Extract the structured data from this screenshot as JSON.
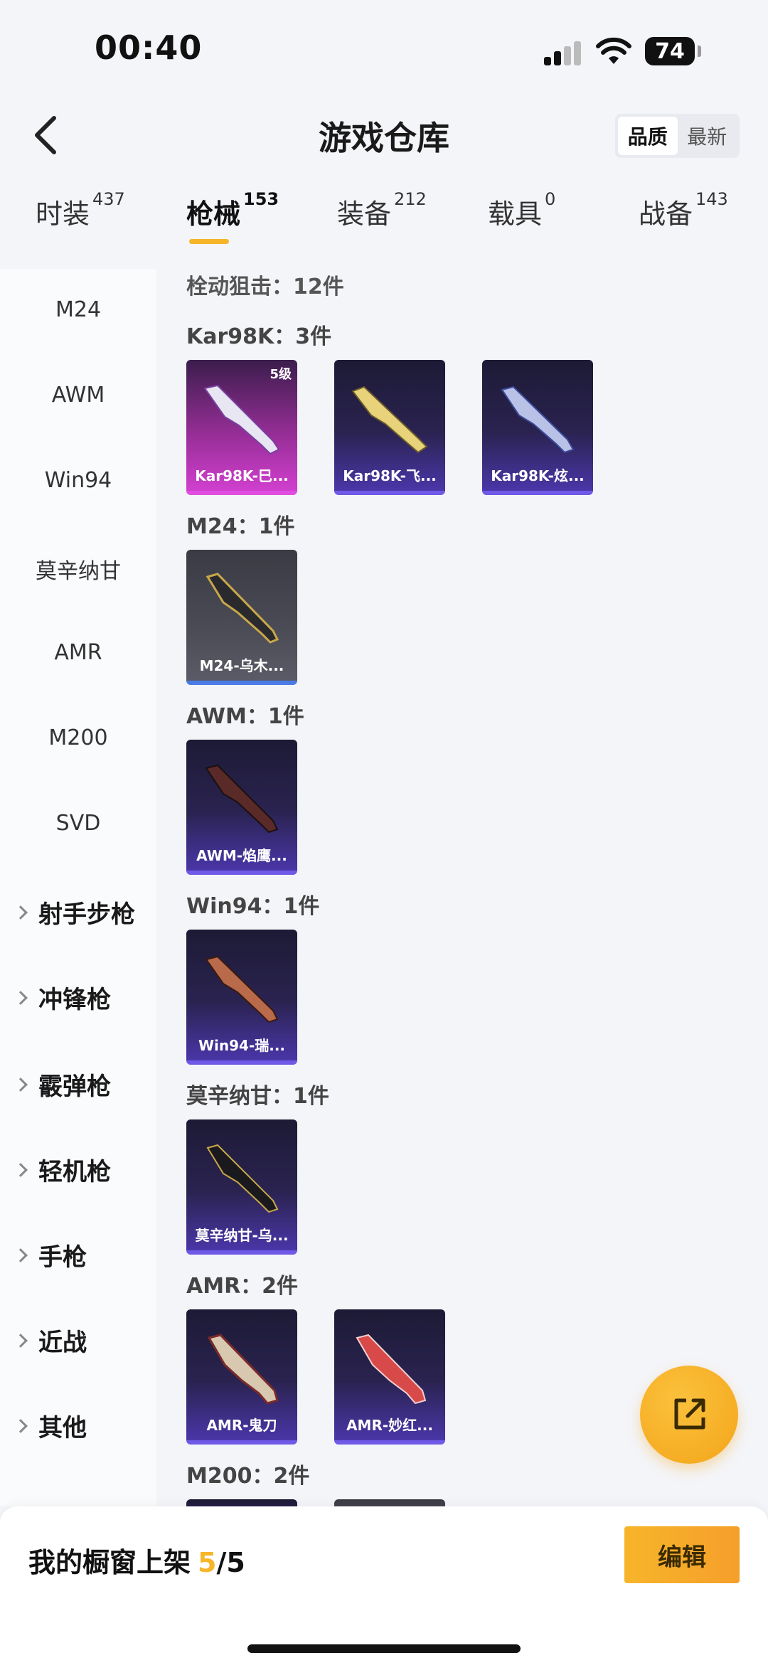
{
  "status": {
    "time": "00:40",
    "battery": "74"
  },
  "header": {
    "title": "游戏仓库",
    "sort_options": [
      "品质",
      "最新"
    ]
  },
  "tabs": [
    {
      "label": "时装",
      "count": "437"
    },
    {
      "label": "枪械",
      "count": "153"
    },
    {
      "label": "装备",
      "count": "212"
    },
    {
      "label": "载具",
      "count": "0"
    },
    {
      "label": "战备",
      "count": "143"
    }
  ],
  "sidebar": {
    "items": [
      "M24",
      "AWM",
      "Win94",
      "莫辛纳甘",
      "AMR",
      "M200",
      "SVD"
    ],
    "groups": [
      "射手步枪",
      "冲锋枪",
      "霰弹枪",
      "轻机枪",
      "手枪",
      "近战",
      "其他"
    ]
  },
  "content": {
    "category_header": "栓动狙击：12件",
    "sections": [
      {
        "title": "Kar98K：3件",
        "cards": [
          {
            "name": "Kar98K-巳...",
            "level": "5级",
            "style": "pink"
          },
          {
            "name": "Kar98K-飞...",
            "style": "purple"
          },
          {
            "name": "Kar98K-炫...",
            "style": "purple"
          }
        ]
      },
      {
        "title": "M24：1件",
        "cards": [
          {
            "name": "M24-乌木...",
            "style": "grey"
          }
        ]
      },
      {
        "title": "AWM：1件",
        "cards": [
          {
            "name": "AWM-焰鹰...",
            "style": "purple"
          }
        ]
      },
      {
        "title": "Win94：1件",
        "cards": [
          {
            "name": "Win94-瑞...",
            "style": "purple"
          }
        ]
      },
      {
        "title": "莫辛纳甘：1件",
        "cards": [
          {
            "name": "莫辛纳甘-乌...",
            "style": "purple"
          }
        ]
      },
      {
        "title": "AMR：2件",
        "cards": [
          {
            "name": "AMR-鬼刀",
            "style": "purple"
          },
          {
            "name": "AMR-妙红...",
            "style": "purple"
          }
        ]
      },
      {
        "title": "M200：2件",
        "cards": []
      }
    ]
  },
  "bottom": {
    "label": "我的橱窗上架",
    "current": "5",
    "total": "/5",
    "edit": "编辑"
  },
  "colors": {
    "accent": "#f7b52a",
    "purple": "#6f59e6",
    "pink": "#d03fce"
  }
}
